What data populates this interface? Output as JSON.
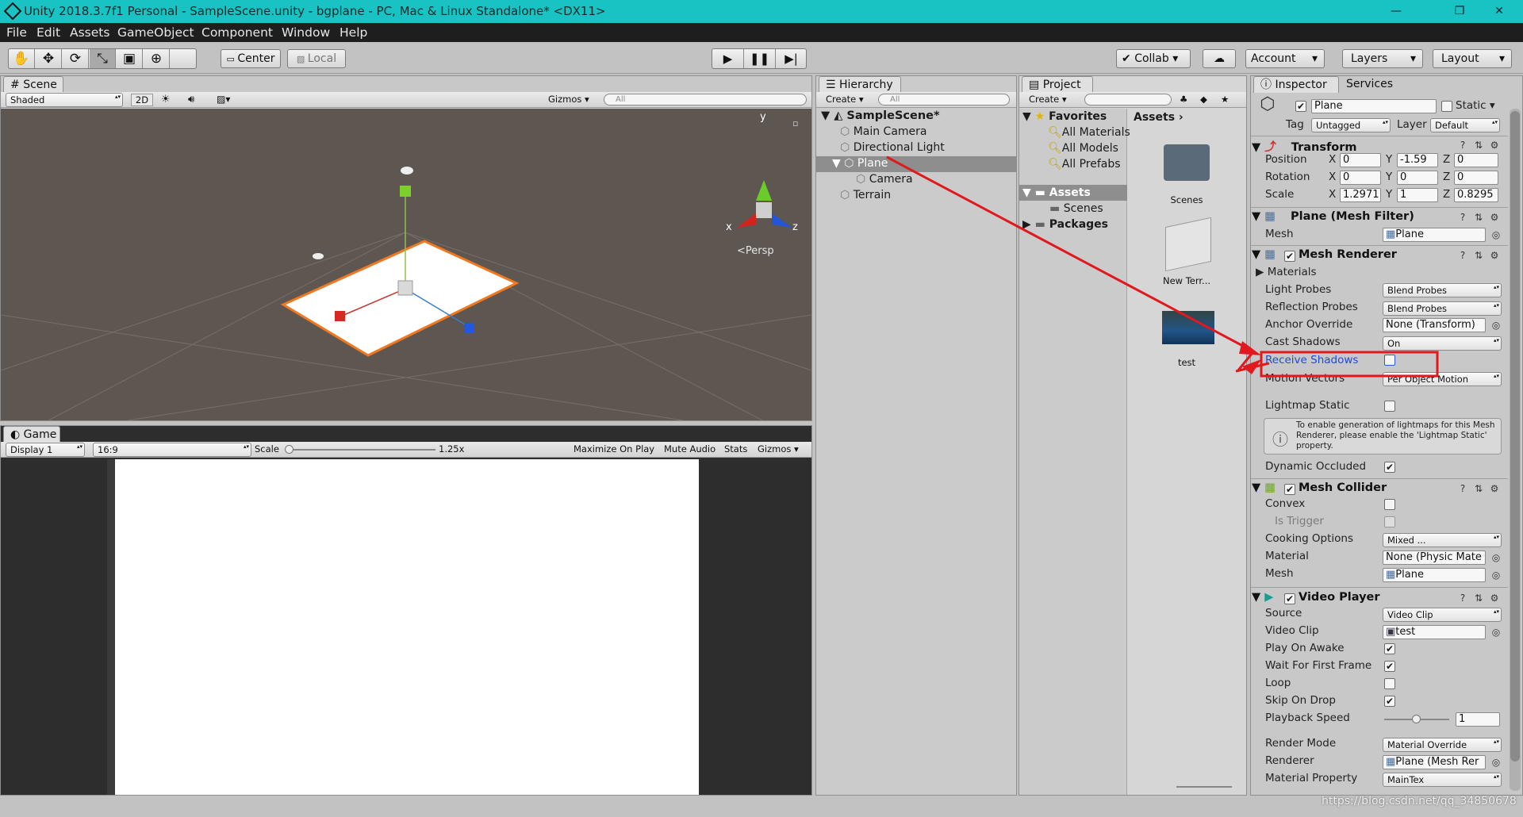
{
  "window": {
    "title": "Unity 2018.3.7f1 Personal - SampleScene.unity - bgplane - PC, Mac & Linux Standalone* <DX11>",
    "min": "—",
    "max": "❐",
    "close": "✕"
  },
  "menu": [
    "File",
    "Edit",
    "Assets",
    "GameObject",
    "Component",
    "Window",
    "Help"
  ],
  "toolbar": {
    "center": "Center",
    "local": "Local",
    "collab": "Collab",
    "account": "Account",
    "layers": "Layers",
    "layout": "Layout"
  },
  "scene": {
    "tab": "Scene",
    "shaded": "Shaded",
    "mode2d": "2D",
    "gizmos": "Gizmos",
    "search_placeholder": "All",
    "persp": "Persp",
    "axis_y": "y",
    "axis_x": "x",
    "axis_z": "z"
  },
  "game": {
    "tab": "Game",
    "display": "Display 1",
    "aspect": "16:9",
    "scale_label": "Scale",
    "scale_value": "1.25x",
    "maximize": "Maximize On Play",
    "mute": "Mute Audio",
    "stats": "Stats",
    "gizmos": "Gizmos"
  },
  "hierarchy": {
    "tab": "Hierarchy",
    "create": "Create",
    "search_placeholder": "All",
    "scene": "SampleScene*",
    "items": [
      "Main Camera",
      "Directional Light",
      "Plane",
      "Camera",
      "Terrain"
    ]
  },
  "project": {
    "tab": "Project",
    "create": "Create",
    "favorites": "Favorites",
    "fav_items": [
      "All Materials",
      "All Models",
      "All Prefabs"
    ],
    "assets_root": "Assets",
    "assets_children": [
      "Scenes"
    ],
    "packages": "Packages",
    "breadcrumb": "Assets",
    "grid": [
      "Scenes",
      "New Terr...",
      "test"
    ]
  },
  "inspector": {
    "tab": "Inspector",
    "tab2": "Services",
    "name": "Plane",
    "static": "Static",
    "tag_label": "Tag",
    "tag": "Untagged",
    "layer_label": "Layer",
    "layer": "Default",
    "transform": {
      "title": "Transform",
      "rows": [
        {
          "label": "Position",
          "x": "0",
          "y": "-1.59",
          "z": "0"
        },
        {
          "label": "Rotation",
          "x": "0",
          "y": "0",
          "z": "0"
        },
        {
          "label": "Scale",
          "x": "1.2971",
          "y": "1",
          "z": "0.8295"
        }
      ]
    },
    "meshfilter": {
      "title": "Plane (Mesh Filter)",
      "mesh_label": "Mesh",
      "mesh": "Plane"
    },
    "meshrenderer": {
      "title": "Mesh Renderer",
      "materials": "Materials",
      "light_probes": "Light Probes",
      "light_probes_v": "Blend Probes",
      "reflection_probes": "Reflection Probes",
      "reflection_probes_v": "Blend Probes",
      "anchor": "Anchor Override",
      "anchor_v": "None (Transform)",
      "cast": "Cast Shadows",
      "cast_v": "On",
      "receive": "Receive Shadows",
      "motion": "Motion Vectors",
      "motion_v": "Per Object Motion",
      "lightmap": "Lightmap Static",
      "help": "To enable generation of lightmaps for this Mesh Renderer, please enable the 'Lightmap Static' property.",
      "occluded": "Dynamic Occluded"
    },
    "meshcollider": {
      "title": "Mesh Collider",
      "convex": "Convex",
      "trigger": "Is Trigger",
      "cooking": "Cooking Options",
      "cooking_v": "Mixed ...",
      "material": "Material",
      "material_v": "None (Physic Mate",
      "mesh": "Mesh",
      "mesh_v": "Plane"
    },
    "videoplayer": {
      "title": "Video Player",
      "source": "Source",
      "source_v": "Video Clip",
      "clip": "Video Clip",
      "clip_v": "test",
      "play": "Play On Awake",
      "wait": "Wait For First Frame",
      "loop": "Loop",
      "skip": "Skip On Drop",
      "speed": "Playback Speed",
      "speed_v": "1",
      "render": "Render Mode",
      "render_v": "Material Override",
      "renderer": "Renderer",
      "renderer_v": "Plane (Mesh Rer",
      "matprop": "Material Property",
      "matprop_v": "MainTex"
    },
    "states": {
      "receive_shadows": false,
      "lightmap_static": false,
      "dynamic_occluded": true,
      "convex": false,
      "is_trigger": false,
      "play_on_awake": true,
      "wait_first_frame": true,
      "loop": false,
      "skip_on_drop": true,
      "playback_speed": 0.5
    }
  },
  "watermark": "https://blog.csdn.net/qq_34850678",
  "colors": {
    "titlebar": "#19c3c3",
    "scene_bg": "#5e5650",
    "selection_orange": "#f07820",
    "annotation_red": "#e0191e",
    "hierarchy_selected": "#8e8e8e"
  }
}
